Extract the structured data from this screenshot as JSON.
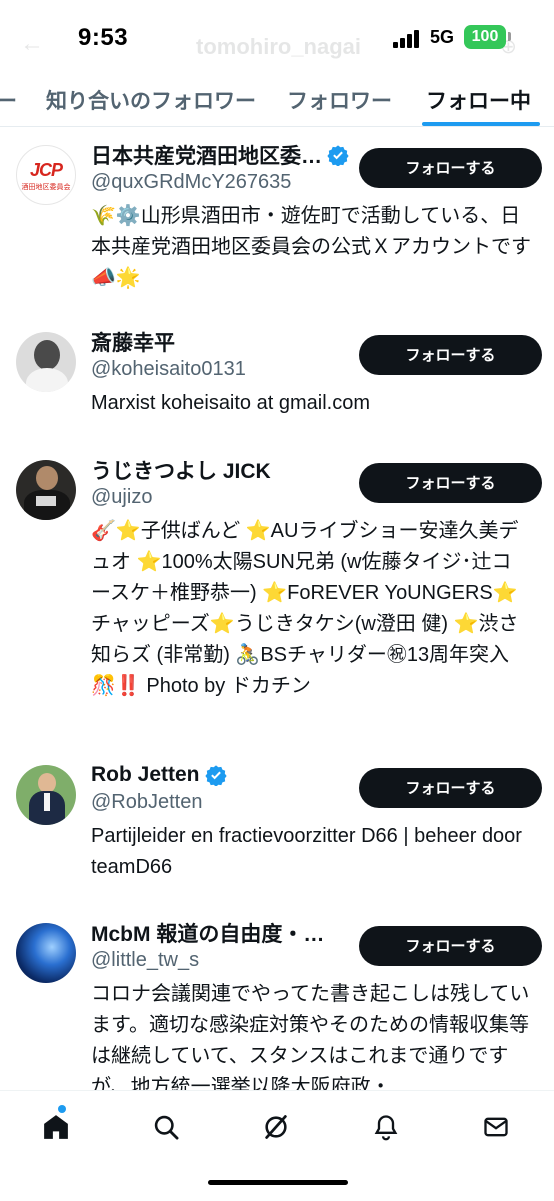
{
  "status_bar": {
    "time": "9:53",
    "network": "5G",
    "battery": "100"
  },
  "header": {
    "title_faded": "tomohiro_nagai"
  },
  "tabs": [
    {
      "label": "ー",
      "active": false
    },
    {
      "label": "知り合いのフォロワー",
      "active": false
    },
    {
      "label": "フォロワー",
      "active": false
    },
    {
      "label": "フォロー中",
      "active": true
    }
  ],
  "follow_label": "フォローする",
  "users": [
    {
      "name": "日本共産党酒田地区委…",
      "verified": true,
      "handle": "@quxGRdMcY267635",
      "bio": "🌾⚙️山形県酒田市・遊佐町で活動している、日本共産党酒田地区委員会の公式Ｘアカウントです📣🌟",
      "avatar_text": "JCP",
      "avatar_sub": "酒田地区委員会"
    },
    {
      "name": "斎藤幸平",
      "verified": false,
      "handle": "@koheisaito0131",
      "bio": "Marxist koheisaito at gmail.com"
    },
    {
      "name": "うじきつよし JICK",
      "verified": false,
      "handle": "@ujizo",
      "bio": "🎸⭐子供ばんど ⭐AUライブショー安達久美デュオ ⭐100%太陽SUN兄弟 (w佐藤タイジ･辻コースケ＋椎野恭一) ⭐FoREVER YoUNGERS⭐チャッピーズ⭐うじきタケシ(w澄田 健) ⭐渋さ知らズ (非常勤) 🚴BSチャリダー㊗13周年突入🎊‼️ Photo by ドカチン"
    },
    {
      "name": "Rob Jetten",
      "verified": true,
      "handle": "@RobJetten",
      "bio": "Partijleider en fractievoorzitter D66 | beheer door teamD66"
    },
    {
      "name": "McbM 報道の自由度・…",
      "verified": false,
      "handle": "@little_tw_s",
      "bio": "コロナ会議関連でやってた書き起こしは残しています。適切な感染症対策やそのための情報収集等は継続していて、スタンスはこれまで通りですが、地方統一選挙以降大阪府政・"
    }
  ],
  "bottom_nav": [
    "home-icon",
    "search-icon",
    "grok-icon",
    "notifications-icon",
    "messages-icon"
  ],
  "colors": {
    "accent": "#1d9bf0",
    "button": "#0f1419",
    "secondary_text": "#536471",
    "battery": "#34c759"
  }
}
